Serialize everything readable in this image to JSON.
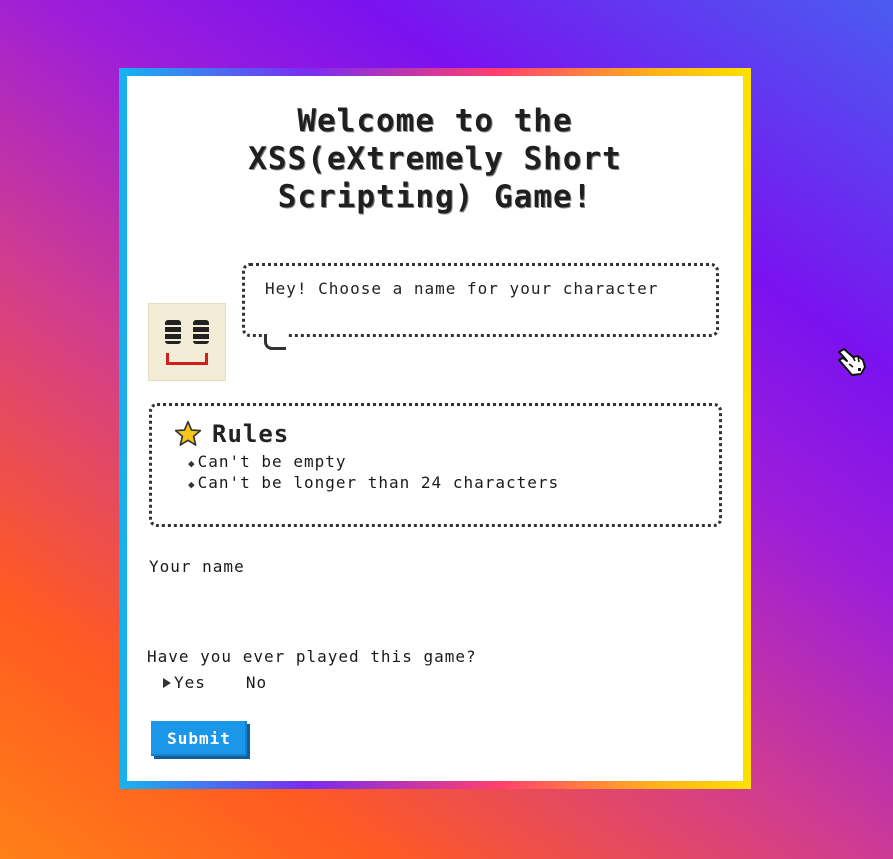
{
  "title": "Welcome to the\nXSS(eXtremely Short\nScripting) Game!",
  "bubble": {
    "text": "Hey! Choose a name for your character"
  },
  "rules": {
    "heading": "Rules",
    "items": [
      "Can't be empty",
      "Can't be longer than 24 characters"
    ]
  },
  "form": {
    "name_label": "Your name",
    "name_value": "",
    "played_label": "Have you ever played this game?",
    "options": [
      "Yes",
      "No"
    ],
    "selected_option": "Yes",
    "submit_label": "Submit"
  },
  "icons": {
    "avatar": "smiley-face-icon",
    "rules": "star-icon",
    "cursor": "pointing-hand-cursor-icon"
  },
  "colors": {
    "submit_bg": "#1c96e8",
    "avatar_mouth": "#d11f1f",
    "star": "#f5c518"
  }
}
